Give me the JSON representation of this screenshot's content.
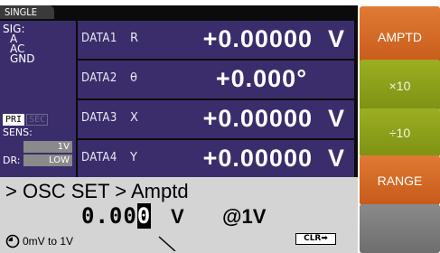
{
  "mode_tab": "SINGLE",
  "left_panel": {
    "sig_label": "SIG:",
    "sig_value": "A",
    "ground_line1": "AC",
    "ground_line2": "GND",
    "pri_label": "PRI",
    "sec_label": "SEC",
    "sens_label": "SENS:",
    "sens_value": "1V",
    "dr_label": "DR:",
    "dr_value": "LOW"
  },
  "data_rows": [
    {
      "label": "DATA1",
      "symbol": "R",
      "value": "+0.00000  V"
    },
    {
      "label": "DATA2",
      "symbol": "θ",
      "value": "+0.000°"
    },
    {
      "label": "DATA3",
      "symbol": "X",
      "value": "+0.00000  V"
    },
    {
      "label": "DATA4",
      "symbol": "Y",
      "value": "+0.00000  V"
    }
  ],
  "entry": {
    "path": "> OSC SET > Amptd",
    "value_prefix": "0.00",
    "value_cursor": "0",
    "unit": "V",
    "range": "@1V",
    "limit": "0mV to 1V",
    "clr_label": "CLR➡"
  },
  "softkeys": [
    {
      "label": "AMPTD",
      "color": "#d96e2a"
    },
    {
      "label": "×10",
      "color": "#8fa31b"
    },
    {
      "label": "÷10",
      "color": "#8fa31b"
    },
    {
      "label": "RANGE",
      "color": "#d96e2a"
    },
    {
      "label": "",
      "color": "#7a7a7a"
    }
  ],
  "colors": {
    "panel_purple": "#3b2d6b",
    "entry_gray": "#d4d4d4",
    "screen_black": "#0b0b0b"
  }
}
